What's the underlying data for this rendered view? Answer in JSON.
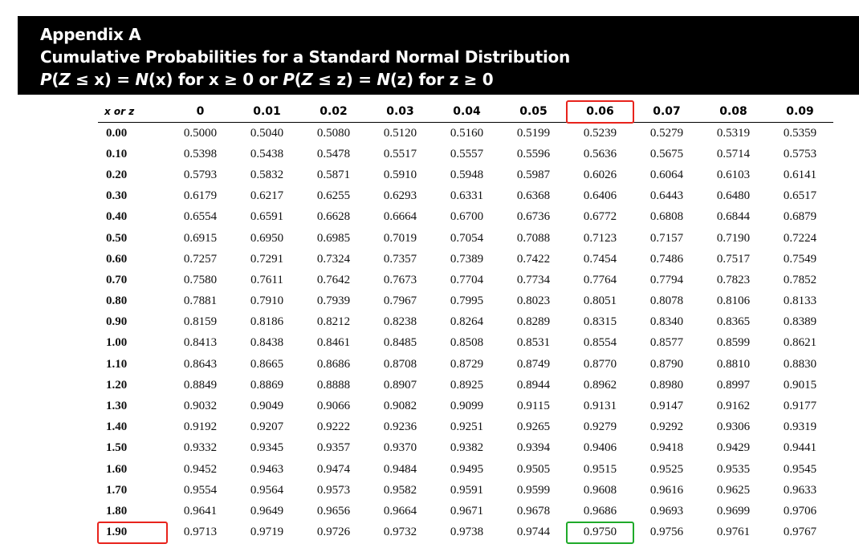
{
  "header": {
    "line1": "Appendix A",
    "line2": "Cumulative Probabilities for a Standard Normal Distribution",
    "line3": "P(Z ≤ x) = N(x) for x ≥ 0 or P(Z ≤ z) = N(z) for z ≥ 0"
  },
  "table": {
    "corner_label": "x or z",
    "columns": [
      "0",
      "0.01",
      "0.02",
      "0.03",
      "0.04",
      "0.05",
      "0.06",
      "0.07",
      "0.08",
      "0.09"
    ],
    "highlighted_column": "0.06",
    "highlighted_row": "1.90",
    "highlight_colors": {
      "header": "#e8231c",
      "row": "#e8231c",
      "cell": "#1faa2a"
    },
    "rows": [
      {
        "z": "0.00",
        "values": [
          "0.5000",
          "0.5040",
          "0.5080",
          "0.5120",
          "0.5160",
          "0.5199",
          "0.5239",
          "0.5279",
          "0.5319",
          "0.5359"
        ]
      },
      {
        "z": "0.10",
        "values": [
          "0.5398",
          "0.5438",
          "0.5478",
          "0.5517",
          "0.5557",
          "0.5596",
          "0.5636",
          "0.5675",
          "0.5714",
          "0.5753"
        ]
      },
      {
        "z": "0.20",
        "values": [
          "0.5793",
          "0.5832",
          "0.5871",
          "0.5910",
          "0.5948",
          "0.5987",
          "0.6026",
          "0.6064",
          "0.6103",
          "0.6141"
        ]
      },
      {
        "z": "0.30",
        "values": [
          "0.6179",
          "0.6217",
          "0.6255",
          "0.6293",
          "0.6331",
          "0.6368",
          "0.6406",
          "0.6443",
          "0.6480",
          "0.6517"
        ]
      },
      {
        "z": "0.40",
        "values": [
          "0.6554",
          "0.6591",
          "0.6628",
          "0.6664",
          "0.6700",
          "0.6736",
          "0.6772",
          "0.6808",
          "0.6844",
          "0.6879"
        ]
      },
      {
        "z": "0.50",
        "values": [
          "0.6915",
          "0.6950",
          "0.6985",
          "0.7019",
          "0.7054",
          "0.7088",
          "0.7123",
          "0.7157",
          "0.7190",
          "0.7224"
        ]
      },
      {
        "z": "0.60",
        "values": [
          "0.7257",
          "0.7291",
          "0.7324",
          "0.7357",
          "0.7389",
          "0.7422",
          "0.7454",
          "0.7486",
          "0.7517",
          "0.7549"
        ]
      },
      {
        "z": "0.70",
        "values": [
          "0.7580",
          "0.7611",
          "0.7642",
          "0.7673",
          "0.7704",
          "0.7734",
          "0.7764",
          "0.7794",
          "0.7823",
          "0.7852"
        ]
      },
      {
        "z": "0.80",
        "values": [
          "0.7881",
          "0.7910",
          "0.7939",
          "0.7967",
          "0.7995",
          "0.8023",
          "0.8051",
          "0.8078",
          "0.8106",
          "0.8133"
        ]
      },
      {
        "z": "0.90",
        "values": [
          "0.8159",
          "0.8186",
          "0.8212",
          "0.8238",
          "0.8264",
          "0.8289",
          "0.8315",
          "0.8340",
          "0.8365",
          "0.8389"
        ]
      },
      {
        "z": "1.00",
        "values": [
          "0.8413",
          "0.8438",
          "0.8461",
          "0.8485",
          "0.8508",
          "0.8531",
          "0.8554",
          "0.8577",
          "0.8599",
          "0.8621"
        ]
      },
      {
        "z": "1.10",
        "values": [
          "0.8643",
          "0.8665",
          "0.8686",
          "0.8708",
          "0.8729",
          "0.8749",
          "0.8770",
          "0.8790",
          "0.8810",
          "0.8830"
        ]
      },
      {
        "z": "1.20",
        "values": [
          "0.8849",
          "0.8869",
          "0.8888",
          "0.8907",
          "0.8925",
          "0.8944",
          "0.8962",
          "0.8980",
          "0.8997",
          "0.9015"
        ]
      },
      {
        "z": "1.30",
        "values": [
          "0.9032",
          "0.9049",
          "0.9066",
          "0.9082",
          "0.9099",
          "0.9115",
          "0.9131",
          "0.9147",
          "0.9162",
          "0.9177"
        ]
      },
      {
        "z": "1.40",
        "values": [
          "0.9192",
          "0.9207",
          "0.9222",
          "0.9236",
          "0.9251",
          "0.9265",
          "0.9279",
          "0.9292",
          "0.9306",
          "0.9319"
        ]
      },
      {
        "z": "1.50",
        "values": [
          "0.9332",
          "0.9345",
          "0.9357",
          "0.9370",
          "0.9382",
          "0.9394",
          "0.9406",
          "0.9418",
          "0.9429",
          "0.9441"
        ]
      },
      {
        "z": "1.60",
        "values": [
          "0.9452",
          "0.9463",
          "0.9474",
          "0.9484",
          "0.9495",
          "0.9505",
          "0.9515",
          "0.9525",
          "0.9535",
          "0.9545"
        ]
      },
      {
        "z": "1.70",
        "values": [
          "0.9554",
          "0.9564",
          "0.9573",
          "0.9582",
          "0.9591",
          "0.9599",
          "0.9608",
          "0.9616",
          "0.9625",
          "0.9633"
        ]
      },
      {
        "z": "1.80",
        "values": [
          "0.9641",
          "0.9649",
          "0.9656",
          "0.9664",
          "0.9671",
          "0.9678",
          "0.9686",
          "0.9693",
          "0.9699",
          "0.9706"
        ]
      },
      {
        "z": "1.90",
        "values": [
          "0.9713",
          "0.9719",
          "0.9726",
          "0.9732",
          "0.9738",
          "0.9744",
          "0.9750",
          "0.9756",
          "0.9761",
          "0.9767"
        ]
      }
    ]
  }
}
